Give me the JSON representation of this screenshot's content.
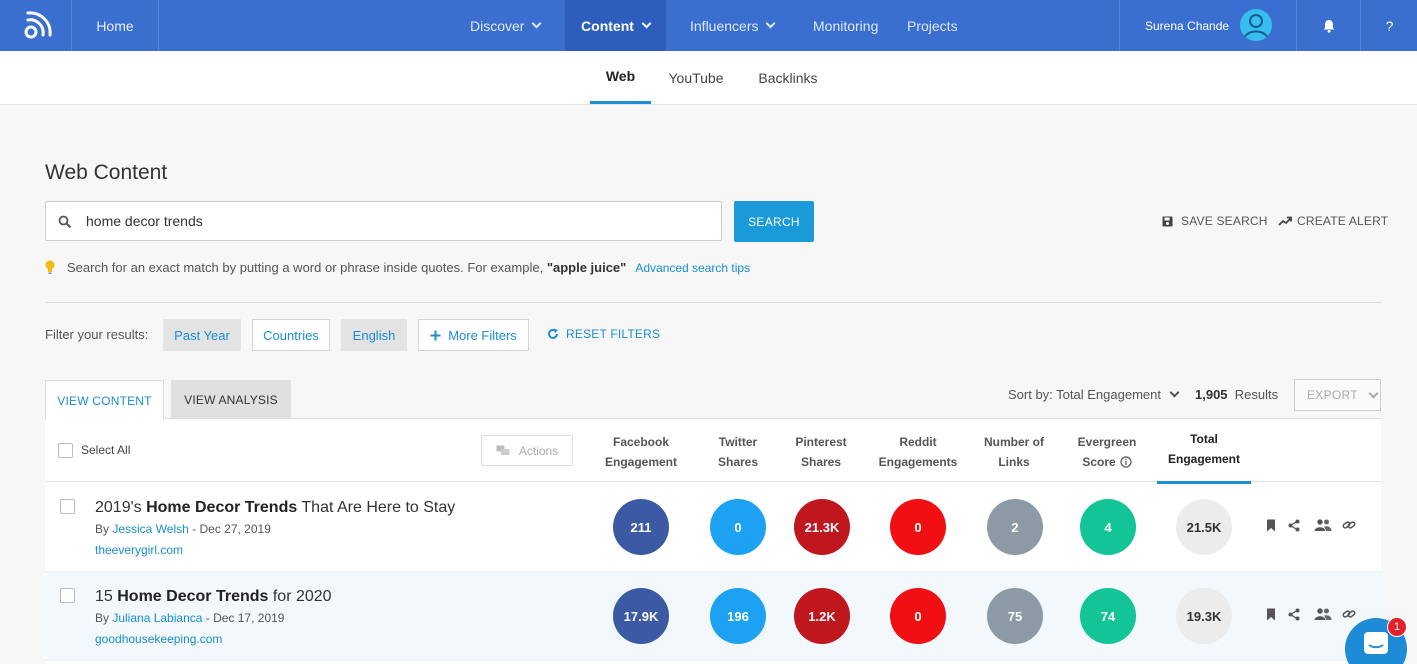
{
  "nav": {
    "home": "Home",
    "discover": "Discover",
    "content": "Content",
    "influencers": "Influencers",
    "monitoring": "Monitoring",
    "projects": "Projects",
    "user_name": "Surena Chande",
    "help": "?"
  },
  "subnav": {
    "web": "Web",
    "youtube": "YouTube",
    "backlinks": "Backlinks"
  },
  "page_title": "Web Content",
  "search": {
    "value": "home decor trends",
    "button": "SEARCH"
  },
  "save_search": "SAVE SEARCH",
  "create_alert": "CREATE ALERT",
  "tip": {
    "text": "Search for an exact match by putting a word or phrase inside quotes. For example, ",
    "example": "\"apple juice\"",
    "link": "Advanced search tips"
  },
  "filters": {
    "label": "Filter your results:",
    "past_year": "Past Year",
    "countries": "Countries",
    "english": "English",
    "more": "More Filters",
    "reset": "RESET FILTERS"
  },
  "view_tabs": {
    "content": "VIEW CONTENT",
    "analysis": "VIEW ANALYSIS"
  },
  "sort_by": "Sort by: Total Engagement",
  "results_count": "1,905",
  "results_label": "Results",
  "export": "EXPORT",
  "table": {
    "select_all": "Select All",
    "actions": "Actions",
    "columns": {
      "facebook": [
        "Facebook",
        "Engagement"
      ],
      "twitter": [
        "Twitter",
        "Shares"
      ],
      "pinterest": [
        "Pinterest",
        "Shares"
      ],
      "reddit": [
        "Reddit",
        "Engagements"
      ],
      "links": [
        "Number of",
        "Links"
      ],
      "evergreen": [
        "Evergreen",
        "Score"
      ],
      "total": [
        "Total",
        "Engagement"
      ]
    },
    "rows": [
      {
        "title_pre": "2019's ",
        "title_bold": "Home Decor Trends",
        "title_post": " That Are Here to Stay",
        "by": "By ",
        "author": "Jessica Welsh",
        "date": " - Dec 27, 2019",
        "domain": "theeverygirl.com",
        "facebook": "211",
        "twitter": "0",
        "pinterest": "21.3K",
        "reddit": "0",
        "links": "2",
        "evergreen": "4",
        "total": "21.5K"
      },
      {
        "title_pre": "15 ",
        "title_bold": "Home Decor Trends",
        "title_post": " for 2020",
        "by": "By ",
        "author": "Juliana Labianca",
        "date": " - Dec 17, 2019",
        "domain": "goodhousekeeping.com",
        "facebook": "17.9K",
        "twitter": "196",
        "pinterest": "1.2K",
        "reddit": "0",
        "links": "75",
        "evergreen": "74",
        "total": "19.3K"
      }
    ]
  },
  "chat_badge": "1",
  "colors": {
    "nav": "#3a6fd0",
    "accent": "#1a9ad9",
    "facebook": "#3c5aa3",
    "twitter": "#1da1f2",
    "pinterest": "#c0161e",
    "reddit": "#f00f12",
    "links": "#8c9aa6",
    "evergreen": "#13c497",
    "total": "#ececec"
  }
}
